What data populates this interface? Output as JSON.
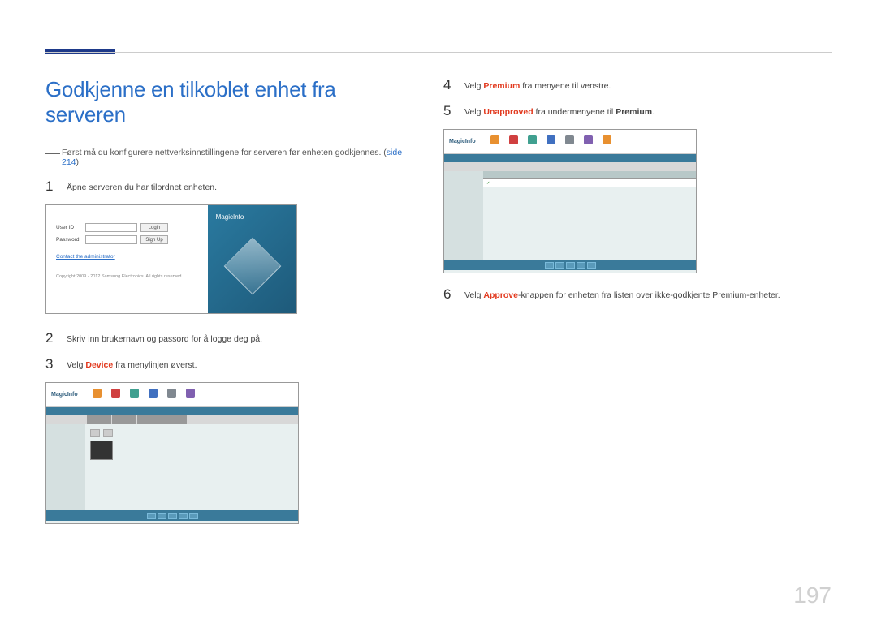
{
  "page_number": "197",
  "title": "Godkjenne en tilkoblet enhet fra serveren",
  "note_prefix": "Først må du konfigurere nettverksinnstillingene for serveren før enheten godkjennes. (",
  "note_link": "side 214",
  "note_suffix": ")",
  "steps": {
    "s1": {
      "num": "1",
      "text": "Åpne serveren du har tilordnet enheten."
    },
    "s2": {
      "num": "2",
      "text": "Skriv inn brukernavn og passord for å logge deg på."
    },
    "s3": {
      "num": "3",
      "pre": "Velg ",
      "em": "Device",
      "post": " fra menylinjen øverst."
    },
    "s4": {
      "num": "4",
      "pre": "Velg ",
      "em": "Premium",
      "post": " fra menyene til venstre."
    },
    "s5": {
      "num": "5",
      "pre": "Velg ",
      "em": "Unapproved",
      "post_pre": " fra undermenyene til ",
      "post_em": "Premium",
      "end": "."
    },
    "s6": {
      "num": "6",
      "pre": "Velg ",
      "em": "Approve",
      "post": "-knappen for enheten fra listen over ikke-godkjente Premium-enheter."
    }
  },
  "login": {
    "user_label": "User ID",
    "pass_label": "Password",
    "login_btn": "Login",
    "signup_btn": "Sign Up",
    "contact": "Contact the administrator",
    "copyright": "Copyright 2009 - 2012 Samsung Electronics. All rights reserved",
    "logo": "MagicInfo"
  },
  "app": {
    "logo": "MagicInfo"
  }
}
